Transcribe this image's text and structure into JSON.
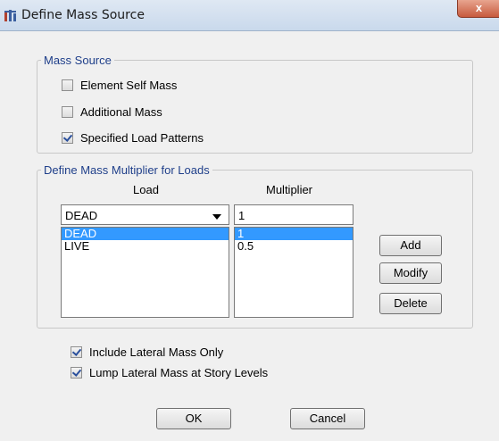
{
  "window": {
    "title": "Define Mass Source",
    "close_label": "x"
  },
  "mass_source": {
    "legend": "Mass Source",
    "options": [
      {
        "label": "Element Self Mass",
        "checked": false
      },
      {
        "label": "Additional Mass",
        "checked": false
      },
      {
        "label": "Specified Load Patterns",
        "checked": true
      }
    ]
  },
  "multiplier": {
    "legend": "Define Mass Multiplier for Loads",
    "load_header": "Load",
    "multiplier_header": "Multiplier",
    "load_selected": "DEAD",
    "multiplier_value": "1",
    "load_list": [
      "DEAD",
      "LIVE"
    ],
    "multiplier_list": [
      "1",
      "0.5"
    ],
    "selected_index": 0,
    "add_label": "Add",
    "modify_label": "Modify",
    "delete_label": "Delete"
  },
  "options": [
    {
      "label": "Include Lateral Mass Only",
      "checked": true
    },
    {
      "label": "Lump Lateral Mass at Story Levels",
      "checked": true
    }
  ],
  "buttons": {
    "ok_label": "OK",
    "cancel_label": "Cancel"
  },
  "colors": {
    "legend_text": "#1f3f8a",
    "selection": "#3399ff",
    "close_button": "#c75a3e"
  }
}
